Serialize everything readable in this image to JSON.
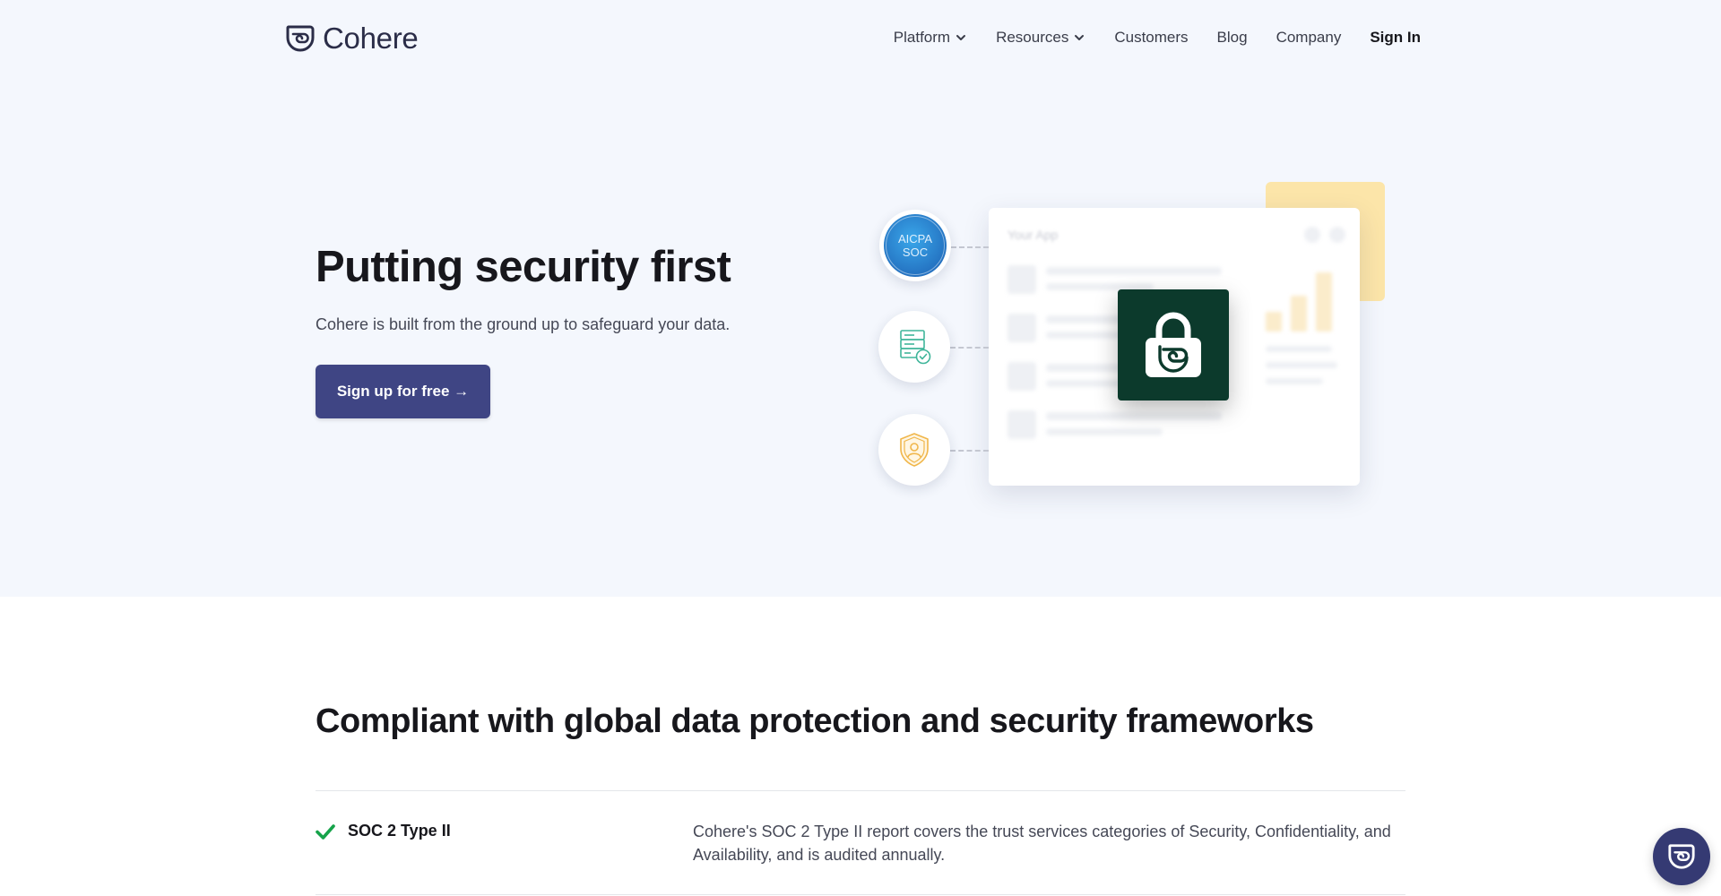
{
  "header": {
    "logo_text": "Cohere",
    "nav": [
      {
        "label": "Platform",
        "has_dropdown": true
      },
      {
        "label": "Resources",
        "has_dropdown": true
      },
      {
        "label": "Customers",
        "has_dropdown": false
      },
      {
        "label": "Blog",
        "has_dropdown": false
      },
      {
        "label": "Company",
        "has_dropdown": false
      }
    ],
    "sign_in": "Sign In"
  },
  "hero": {
    "title": "Putting security first",
    "subtitle": "Cohere is built from the ground up to safeguard your data.",
    "cta_label": "Sign up for free →",
    "illustration": {
      "app_title": "Your App",
      "badge_line1": "AICPA",
      "badge_line2": "SOC",
      "icons": [
        "aicpa-soc-badge",
        "server-check-icon",
        "shield-user-icon",
        "lock-icon"
      ]
    }
  },
  "compliance": {
    "title": "Compliant with global data protection and security frameworks",
    "rows": [
      {
        "name": "SOC 2 Type II",
        "description": "Cohere's SOC 2 Type II report covers the trust services categories of Security, Confidentiality, and Availability, and is audited annually."
      }
    ]
  },
  "colors": {
    "hero_background": "#f4f7fd",
    "primary_button": "#3f4584",
    "lock_tile": "#0c3a2c",
    "check_green": "#16a34a",
    "chat_button": "#353a73"
  }
}
